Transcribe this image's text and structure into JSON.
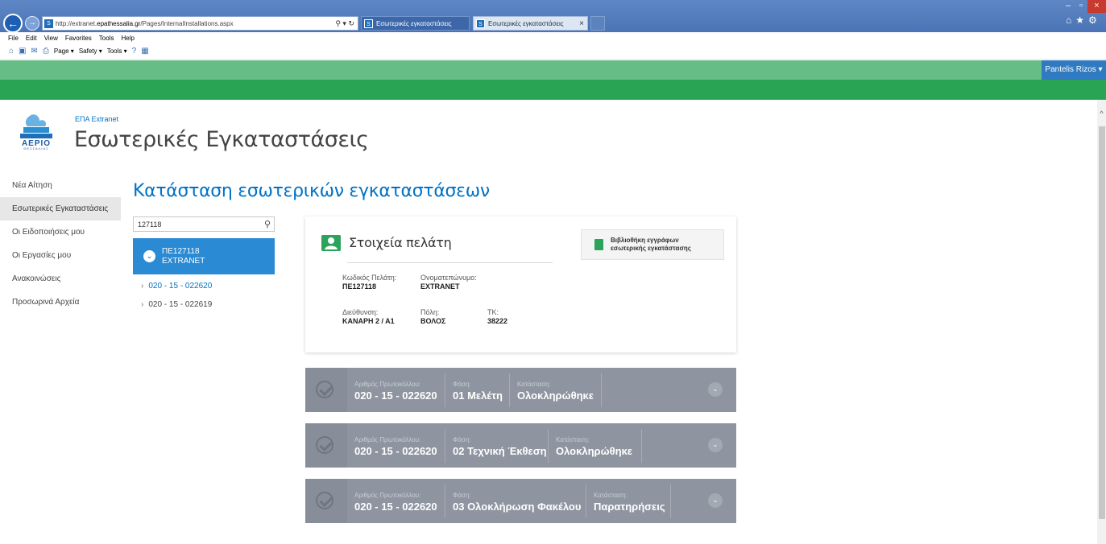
{
  "browser": {
    "url_prefix": "http://extranet.",
    "url_domain": "epathessalia.gr",
    "url_path": "/Pages/InternalInstallations.aspx",
    "addr_buttons": "⚲ ▾ ↻",
    "tabs": [
      {
        "label": "Εσωτερικές εγκαταστάσεις"
      },
      {
        "label": "Εσωτερικές εγκαταστάσεις"
      }
    ],
    "tab_close": "×",
    "favicon": "S",
    "win_min": "–",
    "win_max": "▫",
    "win_close": "×",
    "right_icons": "⌂★⚙"
  },
  "menubar": [
    "File",
    "Edit",
    "View",
    "Favorites",
    "Tools",
    "Help"
  ],
  "cmdbar": {
    "home_icon": "⌂",
    "feeds_icon": "▣",
    "mail_icon": "✉",
    "print_icon": "⎙",
    "page": "Page ▾",
    "safety": "Safety ▾",
    "tools": "Tools ▾",
    "help_icon": "?",
    "extra_icon": "▦"
  },
  "suitebar": {
    "user": "Pantelis Rizos ▾"
  },
  "site": {
    "subtitle": "ΕΠΑ Extranet",
    "title": "Εσωτερικές Εγκαταστάσεις"
  },
  "leftnav": [
    {
      "label": "Νέα Αίτηση"
    },
    {
      "label": "Εσωτερικές Εγκαταστάσεις"
    },
    {
      "label": "Οι Ειδοποιήσεις μου"
    },
    {
      "label": "Οι Εργασίες μου"
    },
    {
      "label": "Ανακοινώσεις"
    },
    {
      "label": "Προσωρινά Αρχεία"
    }
  ],
  "page_title": "Κατάσταση εσωτερικών εγκαταστάσεων",
  "search": {
    "value": "127118",
    "icon": "⚲"
  },
  "customer": {
    "code": "ΠΕ127118",
    "name": "EXTRANET",
    "chevron": "⌄"
  },
  "protocols": [
    {
      "label": "020 - 15 - 022620",
      "arrow": "›"
    },
    {
      "label": "020 - 15 - 022619",
      "arrow": "›"
    }
  ],
  "card": {
    "title": "Στοιχεία πελάτη",
    "library_btn_line1": "Βιβλιοθήκη εγγράφων",
    "library_btn_line2": "εσωτερικής εγκατάστασης",
    "fields": {
      "code_label": "Κωδικός Πελάτη:",
      "code_value": "ΠΕ127118",
      "name_label": "Ονοματεπώνυμο:",
      "name_value": "EXTRANET",
      "address_label": "Διεύθυνση:",
      "address_value": "ΚΑΝΑΡΗ 2 / Α1",
      "city_label": "Πόλη:",
      "city_value": "ΒΟΛΟΣ",
      "zip_label": "ΤΚ:",
      "zip_value": "38222"
    }
  },
  "bars": [
    {
      "proto_label": "Αριθμός Πρωτοκόλλου:",
      "proto": "020 - 15 - 022620",
      "phase_label": "Φάση:",
      "phase": "01 Μελέτη",
      "status_label": "Κατάσταση:",
      "status": "Ολοκληρώθηκε",
      "expand": "⌄"
    },
    {
      "proto_label": "Αριθμός Πρωτοκόλλου:",
      "proto": "020 - 15 - 022620",
      "phase_label": "Φάση:",
      "phase": "02 Τεχνική Έκθεση",
      "status_label": "Κατάσταση:",
      "status": "Ολοκληρώθηκε",
      "expand": "⌄"
    },
    {
      "proto_label": "Αριθμός Πρωτοκόλλου:",
      "proto": "020 - 15 - 022620",
      "phase_label": "Φάση:",
      "phase": "03 Ολοκλήρωση Φακέλου",
      "status_label": "Κατάσταση:",
      "status": "Παρατηρήσεις",
      "expand": "⌄"
    }
  ],
  "scroll_up": "^"
}
